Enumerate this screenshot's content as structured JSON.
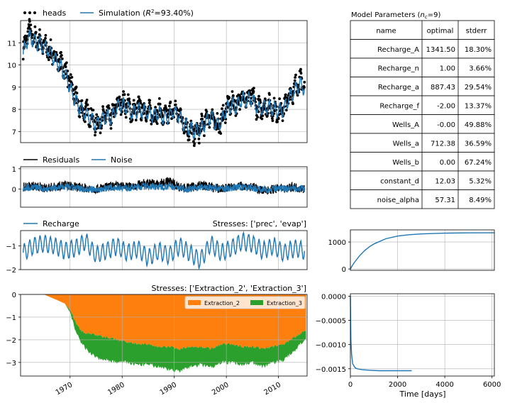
{
  "colors": {
    "heads": "#000000",
    "simulation": "#1f77b4",
    "residuals": "#000000",
    "noise": "#1f77b4",
    "recharge": "#1f77b4",
    "extraction_2": "#ff7f0e",
    "extraction_3": "#2ca02c",
    "grid": "#b0b0b0"
  },
  "legends": {
    "heads": "heads",
    "simulation_prefix": "Simulation (",
    "simulation_r2": "R",
    "simulation_value": "=93.40%)",
    "residuals": "Residuals",
    "noise": "Noise",
    "recharge": "Recharge",
    "extraction_2": "Extraction_2",
    "extraction_3": "Extraction_3"
  },
  "titles": {
    "recharge_stresses": "Stresses: ['prec', 'evap']",
    "wells_stresses": "Stresses: ['Extraction_2', 'Extraction_3']",
    "params_title": "Model Parameters (",
    "params_nc": "n",
    "params_nc_sub": "c",
    "params_nc_val": "=9)"
  },
  "xlabel_right": "Time [days]",
  "x_ticks_time": [
    "1970",
    "1980",
    "1990",
    "2000",
    "2010"
  ],
  "x_ticks_days": [
    "0",
    "2000",
    "4000",
    "6000"
  ],
  "y_ticks": {
    "heads": [
      "7",
      "8",
      "9",
      "10",
      "11"
    ],
    "residuals": [
      "0",
      "1"
    ],
    "recharge": [
      "−2",
      "−1"
    ],
    "wells": [
      "−3",
      "−2",
      "−1",
      "0"
    ],
    "step_recharge": [
      "0",
      "1000"
    ],
    "step_wells": [
      "−0.0015",
      "−0.0010",
      "−0.0005",
      "0.0000"
    ]
  },
  "table": {
    "headers": [
      "name",
      "optimal",
      "stderr"
    ],
    "rows": [
      [
        "Recharge_A",
        "1341.50",
        "18.30%"
      ],
      [
        "Recharge_n",
        "1.00",
        "3.66%"
      ],
      [
        "Recharge_a",
        "887.43",
        "29.54%"
      ],
      [
        "Recharge_f",
        "-2.00",
        "13.37%"
      ],
      [
        "Wells_A",
        "-0.00",
        "49.88%"
      ],
      [
        "Wells_a",
        "712.38",
        "36.59%"
      ],
      [
        "Wells_b",
        "0.00",
        "67.24%"
      ],
      [
        "constant_d",
        "12.03",
        "5.32%"
      ],
      [
        "noise_alpha",
        "57.31",
        "8.49%"
      ]
    ]
  },
  "chart_data": [
    {
      "type": "scatter+line",
      "panel": "heads",
      "xlim": [
        1960.5,
        2015.5
      ],
      "ylim": [
        6.5,
        12.0
      ],
      "grid": true,
      "legend": "top-left-outside",
      "series": [
        {
          "name": "heads",
          "kind": "scatter",
          "x": [
            1961,
            1962,
            1963,
            1964,
            1965,
            1966,
            1967,
            1968,
            1969,
            1970,
            1971,
            1972,
            1973,
            1974,
            1975,
            1976,
            1977,
            1978,
            1979,
            1980,
            1981,
            1982,
            1983,
            1984,
            1985,
            1986,
            1987,
            1988,
            1989,
            1990,
            1991,
            1992,
            1993,
            1994,
            1995,
            1996,
            1997,
            1998,
            1999,
            2000,
            2001,
            2002,
            2003,
            2004,
            2005,
            2006,
            2007,
            2008,
            2009,
            2010,
            2011,
            2012,
            2013,
            2014,
            2015
          ],
          "y": [
            10.6,
            11.6,
            11.2,
            11.1,
            10.9,
            10.6,
            10.4,
            10.1,
            9.8,
            9.2,
            8.6,
            8.0,
            7.9,
            7.7,
            7.3,
            7.5,
            7.8,
            7.6,
            8.2,
            8.3,
            8.2,
            7.8,
            8.1,
            8.0,
            7.9,
            7.7,
            8.0,
            7.6,
            7.8,
            8.0,
            7.8,
            7.3,
            7.0,
            6.9,
            7.1,
            7.5,
            7.8,
            7.3,
            7.4,
            8.1,
            8.3,
            8.2,
            8.6,
            8.5,
            8.6,
            8.0,
            8.1,
            8.2,
            8.0,
            7.9,
            8.0,
            8.6,
            8.9,
            9.3,
            9.1
          ]
        },
        {
          "name": "Simulation",
          "kind": "line",
          "x": [
            1961,
            1962,
            1963,
            1964,
            1965,
            1966,
            1967,
            1968,
            1969,
            1970,
            1971,
            1972,
            1973,
            1974,
            1975,
            1976,
            1977,
            1978,
            1979,
            1980,
            1981,
            1982,
            1983,
            1984,
            1985,
            1986,
            1987,
            1988,
            1989,
            1990,
            1991,
            1992,
            1993,
            1994,
            1995,
            1996,
            1997,
            1998,
            1999,
            2000,
            2001,
            2002,
            2003,
            2004,
            2005,
            2006,
            2007,
            2008,
            2009,
            2010,
            2011,
            2012,
            2013,
            2014,
            2015
          ],
          "y": [
            10.5,
            11.3,
            11.1,
            11.0,
            10.8,
            10.6,
            10.3,
            10.0,
            9.6,
            9.0,
            8.4,
            8.0,
            7.8,
            7.6,
            7.3,
            7.5,
            7.7,
            7.6,
            8.1,
            8.2,
            8.1,
            7.8,
            8.0,
            7.9,
            7.8,
            7.7,
            7.9,
            7.6,
            7.7,
            7.9,
            7.7,
            7.3,
            7.1,
            7.0,
            7.1,
            7.4,
            7.7,
            7.3,
            7.4,
            8.0,
            8.2,
            8.1,
            8.5,
            8.4,
            8.5,
            8.0,
            8.1,
            8.1,
            8.0,
            7.9,
            8.0,
            8.5,
            8.8,
            9.1,
            9.0
          ]
        }
      ]
    },
    {
      "type": "line",
      "panel": "residuals",
      "xlim": [
        1960.5,
        2015.5
      ],
      "ylim": [
        -0.9,
        1.1
      ],
      "grid": true,
      "series": [
        {
          "name": "Residuals",
          "x": [
            1961,
            1963,
            1965,
            1967,
            1969,
            1971,
            1973,
            1975,
            1977,
            1979,
            1981,
            1983,
            1985,
            1987,
            1989,
            1991,
            1993,
            1995,
            1997,
            1999,
            2001,
            2003,
            2005,
            2007,
            2009,
            2011,
            2013,
            2015
          ],
          "y": [
            0.1,
            0.15,
            0.05,
            0.1,
            0.2,
            0.1,
            0.05,
            0.0,
            0.1,
            0.15,
            0.1,
            0.2,
            0.3,
            0.25,
            0.4,
            0.1,
            0.05,
            0.2,
            0.1,
            0.0,
            0.1,
            0.15,
            0.1,
            -0.1,
            0.0,
            0.05,
            0.1,
            0.0
          ]
        },
        {
          "name": "Noise",
          "x": [
            1961,
            1963,
            1965,
            1967,
            1969,
            1971,
            1973,
            1975,
            1977,
            1979,
            1981,
            1983,
            1985,
            1987,
            1989,
            1991,
            1993,
            1995,
            1997,
            1999,
            2001,
            2003,
            2005,
            2007,
            2009,
            2011,
            2013,
            2015
          ],
          "y": [
            0.05,
            0.1,
            0.0,
            0.05,
            0.1,
            0.05,
            0.0,
            -0.05,
            0.05,
            0.1,
            0.05,
            0.1,
            0.15,
            0.1,
            0.15,
            0.05,
            0.0,
            0.1,
            0.05,
            0.0,
            0.05,
            0.1,
            0.05,
            -0.05,
            0.0,
            0.0,
            0.05,
            0.0
          ]
        }
      ]
    },
    {
      "type": "line",
      "panel": "recharge",
      "title": "Stresses: ['prec', 'evap']",
      "xlim": [
        1960.5,
        2015.5
      ],
      "ylim": [
        -2.0,
        -0.35
      ],
      "grid": true,
      "series": [
        {
          "name": "Recharge",
          "x": [
            1961,
            1963,
            1965,
            1967,
            1969,
            1971,
            1973,
            1975,
            1977,
            1979,
            1981,
            1983,
            1985,
            1987,
            1989,
            1991,
            1993,
            1995,
            1997,
            1999,
            2001,
            2003,
            2005,
            2007,
            2009,
            2011,
            2013,
            2015
          ],
          "y": [
            -1.3,
            -1.0,
            -0.9,
            -1.0,
            -1.2,
            -1.1,
            -0.8,
            -1.4,
            -1.2,
            -1.0,
            -1.3,
            -1.1,
            -1.5,
            -1.2,
            -1.4,
            -1.0,
            -1.3,
            -1.6,
            -0.9,
            -1.3,
            -1.1,
            -0.8,
            -0.9,
            -1.2,
            -1.0,
            -1.3,
            -1.1,
            -1.2
          ]
        }
      ]
    },
    {
      "type": "area",
      "panel": "wells",
      "title": "Stresses: ['Extraction_2', 'Extraction_3']",
      "xlim": [
        1960.5,
        2015.5
      ],
      "ylim": [
        -3.6,
        0.0
      ],
      "grid": true,
      "legend": "top-right",
      "x": [
        1961,
        1965,
        1969,
        1970,
        1971,
        1972,
        1973,
        1975,
        1977,
        1979,
        1981,
        1983,
        1985,
        1987,
        1989,
        1991,
        1993,
        1995,
        1997,
        1999,
        2001,
        2003,
        2005,
        2007,
        2009,
        2011,
        2013,
        2015
      ],
      "series": [
        {
          "name": "Extraction_2",
          "lower": [
            0.0,
            0.0,
            -0.4,
            -0.7,
            -1.2,
            -1.6,
            -1.7,
            -1.8,
            -1.9,
            -2.0,
            -2.1,
            -2.2,
            -2.2,
            -2.3,
            -2.3,
            -2.4,
            -2.3,
            -2.3,
            -2.4,
            -2.2,
            -2.2,
            -2.3,
            -2.3,
            -2.4,
            -2.3,
            -2.2,
            -1.9,
            -1.6
          ]
        },
        {
          "name": "Extraction_3",
          "lower": [
            0.0,
            0.0,
            -0.4,
            -0.8,
            -1.6,
            -2.1,
            -2.4,
            -2.8,
            -2.9,
            -3.0,
            -3.0,
            -3.1,
            -3.1,
            -3.2,
            -3.3,
            -3.4,
            -3.2,
            -3.1,
            -3.2,
            -3.0,
            -3.0,
            -3.1,
            -3.0,
            -3.2,
            -3.0,
            -2.9,
            -2.5,
            -2.0
          ]
        }
      ]
    },
    {
      "type": "line",
      "panel": "step_recharge",
      "xlim": [
        0,
        6100
      ],
      "ylim": [
        -50,
        1450
      ],
      "grid": true,
      "series": [
        {
          "name": "Recharge step",
          "x": [
            0,
            100,
            200,
            400,
            600,
            800,
            1000,
            1500,
            2000,
            2500,
            3000,
            4000,
            5000,
            6100
          ],
          "y": [
            0,
            150,
            280,
            500,
            680,
            820,
            930,
            1120,
            1220,
            1270,
            1300,
            1330,
            1340,
            1341
          ]
        }
      ]
    },
    {
      "type": "line",
      "panel": "step_wells",
      "xlim": [
        0,
        6100
      ],
      "ylim": [
        -0.00165,
        5e-05
      ],
      "xlabel": "Time [days]",
      "grid": true,
      "series": [
        {
          "name": "Wells step",
          "x": [
            0,
            20,
            50,
            100,
            200,
            300,
            500,
            800,
            1200,
            1600,
            2000,
            2600
          ],
          "y": [
            0.0,
            -0.0009,
            -0.0012,
            -0.0014,
            -0.00148,
            -0.0015,
            -0.00152,
            -0.00153,
            -0.00154,
            -0.00154,
            -0.00154,
            -0.00154
          ]
        }
      ]
    }
  ]
}
